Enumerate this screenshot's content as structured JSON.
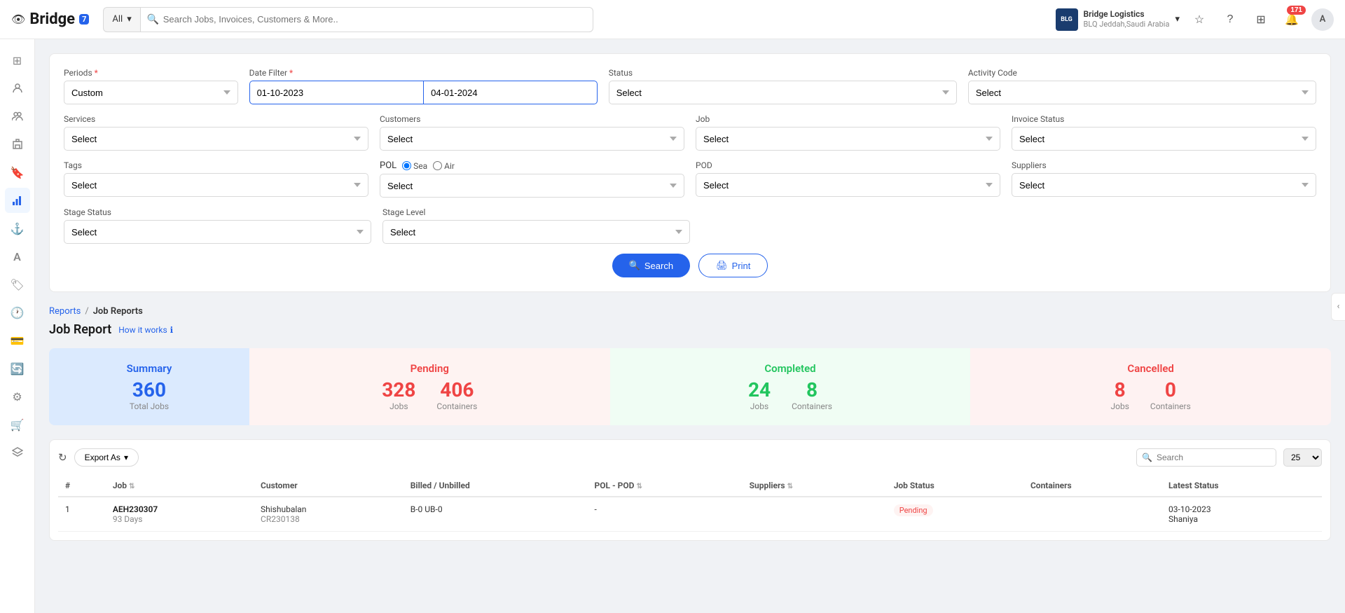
{
  "app": {
    "logo_text": "Bridge",
    "logo_badge": "7",
    "eye_icon": "👁"
  },
  "topnav": {
    "search_placeholder": "Search Jobs, Invoices, Customers & More..",
    "search_type": "All",
    "company_name": "Bridge Logistics",
    "company_sub": "BLQ Jeddah,Saudi Arabia",
    "company_logo": "BLG",
    "notification_count": "171"
  },
  "sidebar": {
    "items": [
      {
        "icon": "⊞",
        "name": "dashboard"
      },
      {
        "icon": "👤",
        "name": "users"
      },
      {
        "icon": "👥",
        "name": "customers"
      },
      {
        "icon": "🏢",
        "name": "company"
      },
      {
        "icon": "🔖",
        "name": "bookmarks"
      },
      {
        "icon": "📋",
        "name": "reports",
        "active": true
      },
      {
        "icon": "⚓",
        "name": "anchor"
      },
      {
        "icon": "A",
        "name": "alpha"
      },
      {
        "icon": "🏷",
        "name": "tags"
      },
      {
        "icon": "🕐",
        "name": "time"
      },
      {
        "icon": "💳",
        "name": "billing"
      },
      {
        "icon": "🔄",
        "name": "sync"
      },
      {
        "icon": "⚙",
        "name": "settings"
      },
      {
        "icon": "🛒",
        "name": "cart"
      },
      {
        "icon": "☰",
        "name": "menu"
      }
    ]
  },
  "filters": {
    "periods_label": "Periods",
    "periods_required": true,
    "periods_value": "Custom",
    "date_filter_label": "Date Filter",
    "date_filter_required": true,
    "date_from": "01-10-2023",
    "date_to": "04-01-2024",
    "status_label": "Status",
    "status_value": "Select",
    "activity_code_label": "Activity Code",
    "activity_code_value": "Select",
    "services_label": "Services",
    "services_value": "Select",
    "customers_label": "Customers",
    "customers_value": "Select",
    "job_label": "Job",
    "job_value": "Select",
    "invoice_status_label": "Invoice Status",
    "invoice_status_value": "Select",
    "tags_label": "Tags",
    "tags_value": "Select",
    "pol_label": "POL",
    "pol_value": "Select",
    "pol_sea": "Sea",
    "pol_air": "Air",
    "pod_label": "POD",
    "pod_value": "Select",
    "suppliers_label": "Suppliers",
    "suppliers_value": "Select",
    "stage_status_label": "Stage Status",
    "stage_status_value": "Select",
    "stage_level_label": "Stage Level",
    "stage_level_value": "Select",
    "search_btn": "Search",
    "print_btn": "Print"
  },
  "breadcrumb": {
    "parent": "Reports",
    "separator": "/",
    "current": "Job Reports"
  },
  "page": {
    "title": "Job Report",
    "how_it_works": "How it works"
  },
  "summary": {
    "title": "Summary",
    "total_label": "Total Jobs",
    "total_value": "360",
    "pending_title": "Pending",
    "pending_jobs": "328",
    "pending_jobs_label": "Jobs",
    "pending_containers": "406",
    "pending_containers_label": "Containers",
    "completed_title": "Completed",
    "completed_jobs": "24",
    "completed_jobs_label": "Jobs",
    "completed_containers": "8",
    "completed_containers_label": "Containers",
    "cancelled_title": "Cancelled",
    "cancelled_jobs": "8",
    "cancelled_jobs_label": "Jobs",
    "cancelled_containers": "0",
    "cancelled_containers_label": "Containers"
  },
  "table": {
    "refresh_icon": "↻",
    "export_label": "Export As",
    "search_placeholder": "Search",
    "per_page": "25",
    "columns": [
      {
        "label": "#",
        "sortable": false
      },
      {
        "label": "Job",
        "sortable": true
      },
      {
        "label": "Customer",
        "sortable": false
      },
      {
        "label": "Billed / Unbilled",
        "sortable": false
      },
      {
        "label": "POL - POD",
        "sortable": true
      },
      {
        "label": "Suppliers",
        "sortable": true
      },
      {
        "label": "Job Status",
        "sortable": false
      },
      {
        "label": "Containers",
        "sortable": false
      },
      {
        "label": "Latest Status",
        "sortable": false
      }
    ],
    "rows": [
      {
        "num": "1",
        "job_code": "AEH230307",
        "job_days": "93 Days",
        "customer": "Shishubalan",
        "customer_ref": "CR230138",
        "billed": "B-0 UB-0",
        "pol_pod": "-",
        "suppliers": "",
        "job_status": "Pending",
        "containers": "",
        "latest_status_date": "03-10-2023",
        "latest_status": "Shaniya"
      }
    ]
  }
}
